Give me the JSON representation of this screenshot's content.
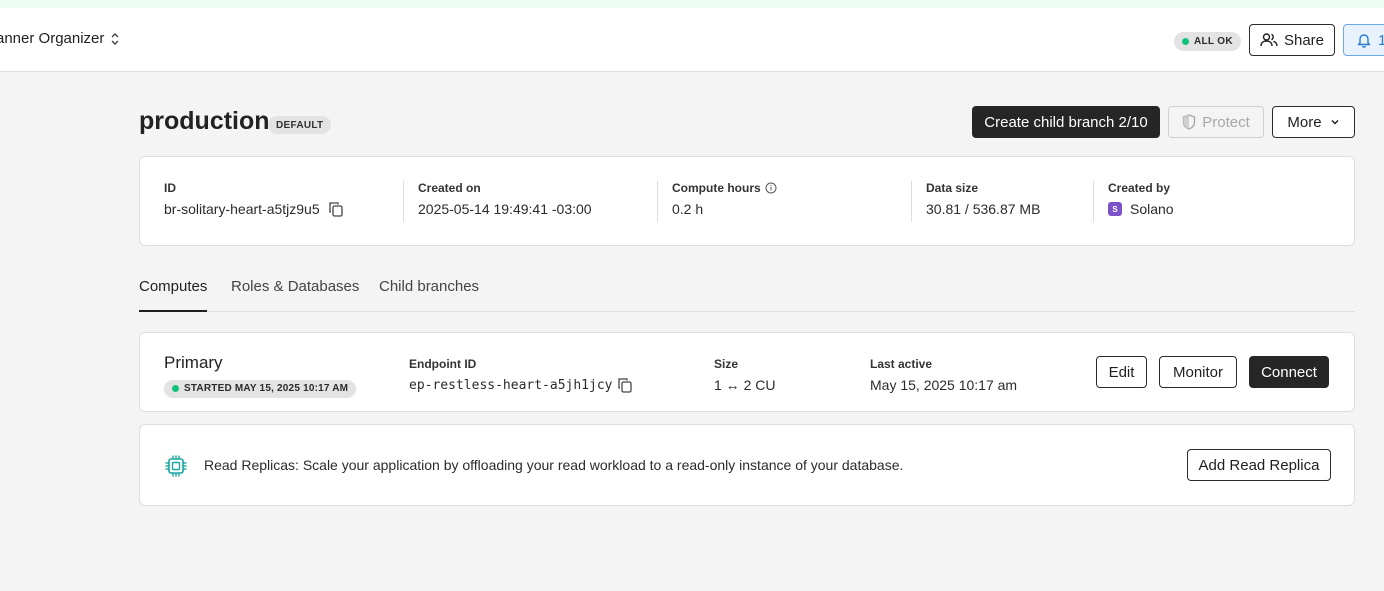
{
  "topbar": {
    "project_name": "anner Organizer",
    "status_label": "ALL OK",
    "share_label": "Share",
    "notifications_count": "1"
  },
  "branch": {
    "name": "production",
    "badge": "DEFAULT",
    "actions": {
      "create_child": "Create child branch 2/10",
      "protect": "Protect",
      "more": "More"
    }
  },
  "info": {
    "id_label": "ID",
    "id_value": "br-solitary-heart-a5tjz9u5",
    "created_on_label": "Created on",
    "created_on_value": "2025-05-14 19:49:41 -03:00",
    "compute_hours_label": "Compute hours",
    "compute_hours_value": "0.2 h",
    "data_size_label": "Data size",
    "data_size_value": "30.81 / 536.87 MB",
    "created_by_label": "Created by",
    "created_by_value": "Solano",
    "created_by_initial": "S"
  },
  "tabs": [
    {
      "label": "Computes"
    },
    {
      "label": "Roles & Databases"
    },
    {
      "label": "Child branches"
    }
  ],
  "compute": {
    "name": "Primary",
    "status": "STARTED MAY 15, 2025 10:17 AM",
    "endpoint_label": "Endpoint ID",
    "endpoint_value": "ep-restless-heart-a5jh1jcy",
    "size_label": "Size",
    "size_value": "1 ↔ 2 CU",
    "last_active_label": "Last active",
    "last_active_value": "May 15, 2025 10:17 am",
    "edit_label": "Edit",
    "monitor_label": "Monitor",
    "connect_label": "Connect"
  },
  "replicas": {
    "text": "Read Replicas: Scale your application by offloading your read workload to a read-only instance of your database.",
    "button_label": "Add Read Replica"
  },
  "colors": {
    "accent_green": "#10c27a",
    "dark_button": "#262626",
    "replica_icon": "#19a7a0",
    "notif_blue": "#2a79d3"
  }
}
